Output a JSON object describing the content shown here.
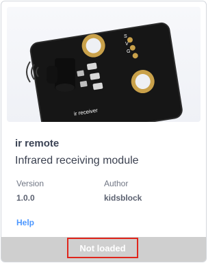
{
  "extension": {
    "title": "ir remote",
    "description": "Infrared receiving module",
    "version_label": "Version",
    "version_value": "1.0.0",
    "author_label": "Author",
    "author_value": "kidsblock",
    "help_label": "Help",
    "status_label": "Not loaded"
  },
  "image": {
    "board_label": "ir receiver",
    "pin_labels": [
      "S",
      "V",
      "G"
    ]
  },
  "colors": {
    "accent": "#4c97ff",
    "highlight_border": "#e0251b",
    "footer_bg": "#cfcfcf"
  }
}
